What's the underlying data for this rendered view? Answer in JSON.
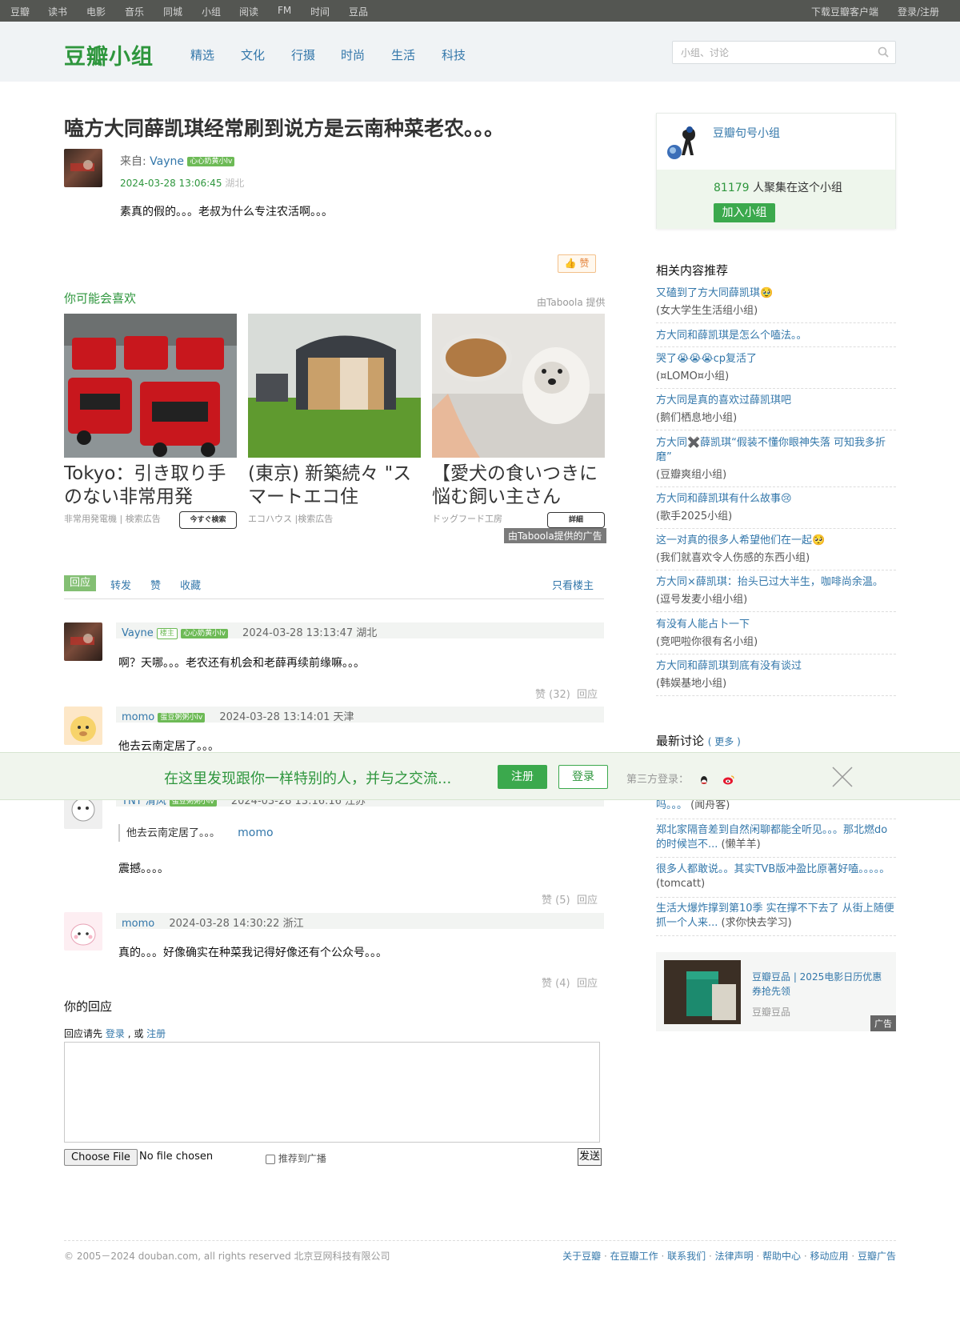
{
  "topnav": {
    "items": [
      "豆瓣",
      "读书",
      "电影",
      "音乐",
      "同城",
      "小组",
      "阅读",
      "FM",
      "时间",
      "豆品"
    ],
    "download": "下载豆瓣客户端",
    "login": "登录/注册"
  },
  "header": {
    "logo": "豆瓣小组",
    "nav": [
      "精选",
      "文化",
      "行摄",
      "时尚",
      "生活",
      "科技"
    ],
    "search_placeholder": "小组、讨论"
  },
  "topic": {
    "title": "嗑方大同薛凯琪经常刷到说方是云南种菜老农。。。",
    "from_label": "来自:",
    "author": "Vayne",
    "author_badge": "心心奶黄小lv",
    "time": "2024-03-28 13:06:45",
    "location": "湖北",
    "content": "素真的假的。。。老叔为什么专注农活啊。。。",
    "like_label": "赞"
  },
  "recommend": {
    "title": "你可能会喜欢",
    "provider": "由Taboola 提供",
    "ads": [
      {
        "title": "Tokyo：引き取り手のない非常用発",
        "source": "非常用発電機 | 検索広告",
        "cta": "今すぐ検索"
      },
      {
        "title": "(東京) 新築続々 \"スマートエコ住",
        "source": "エコハウス |検索広告",
        "cta": ""
      },
      {
        "title": "【愛犬の食いつきに悩む飼い主さん",
        "source": "ドッグフード工房",
        "cta": "詳細"
      }
    ],
    "taboola_tag": "由Taboola提供的广告"
  },
  "tabs": {
    "reply": "回应",
    "repost": "转发",
    "like": "赞",
    "collect": "收藏",
    "only_op": "只看楼主"
  },
  "replies": [
    {
      "name": "Vayne",
      "owner_badge": "楼主",
      "badge": "心心奶黄小lv",
      "time": "2024-03-28 13:13:47 湖北",
      "text": "啊？天哪。。。老农还有机会和老薛再续前缘嘛。。。",
      "likes": "赞 (32)",
      "reply": "回应"
    },
    {
      "name": "momo",
      "badge": "蛋豆粥粥小lv",
      "time": "2024-03-28 13:14:01 天津",
      "text": "他去云南定居了。。。"
    },
    {
      "name": "TNT 清风",
      "badge": "蛋豆粥粥小lv",
      "time": "2024-03-28 13:16:16 江苏",
      "quote": "他去云南定居了。。。",
      "quote_author": "momo",
      "text": "震撼。。。。",
      "likes": "赞 (5)",
      "reply": "回应"
    },
    {
      "name": "momo",
      "time": "2024-03-28 14:30:22 浙江",
      "text": "真的。。。好像确实在种菜我记得好像还有个公众号。。。",
      "likes": "赞 (4)",
      "reply": "回应"
    }
  ],
  "your_reply": {
    "title": "你的回应",
    "prompt_prefix": "回应请先",
    "login": "登录",
    "or": ", 或",
    "register": "注册",
    "file_button": "Choose File",
    "file_status": "No file chosen",
    "recommend_checkbox": "推荐到广播",
    "send": "发送"
  },
  "group": {
    "name": "豆瓣句号小组",
    "count": "81179",
    "count_suffix": "人聚集在这个小组",
    "join": "加入小组"
  },
  "related": {
    "title": "相关内容推荐",
    "items": [
      {
        "title": "又磕到了方大同薛凯琪🥹",
        "group": "(女大学生生活组小组)"
      },
      {
        "title": "方大同和薛凯琪是怎么个嗑法。。",
        "group": ""
      },
      {
        "title": "哭了😭😭😭cp复活了",
        "group": "(¤LOMO¤小组)"
      },
      {
        "title": "方大同是真的喜欢过薛凯琪吧",
        "group": "(鹅们栖息地小组)"
      },
      {
        "title": "方大同✖️薛凯琪“假装不懂你眼神失落 可知我多折磨”",
        "group": "(豆瓣爽组小组)"
      },
      {
        "title": "方大同和薛凯琪有什么故事😢",
        "group": "(歌手2025小组)"
      },
      {
        "title": "这一对真的很多人希望他们在一起🥺",
        "group": "(我们就喜欢令人伤感的东西小组)"
      },
      {
        "title": "方大同×薛凯琪：抬头已过大半生，咖啡尚余温。",
        "group": "(逗号发麦小组小组)"
      },
      {
        "title": "有没有人能占卜一下",
        "group": "(竞吧啦你很有名小组)"
      },
      {
        "title": "方大同和薛凯琪到底有没有谈过",
        "group": "(韩娱基地小组)"
      }
    ]
  },
  "latest": {
    "title": "最新讨论",
    "more": "( 更多 )",
    "items": [
      {
        "title": "吗。。。",
        "author": "(闻舟客)"
      },
      {
        "title": "郑北家隔音差到自然闲聊都能全听见。。。那北燃do的时候岂不...",
        "author": "(懒羊羊)"
      },
      {
        "title": "很多人都敢说。。其实TVB版冲盈比原著好嗑。。。。。",
        "author": "(tomcatt)"
      },
      {
        "title": "生活大爆炸撑到第10季 实在撑不下去了 从街上随便抓一个人来...",
        "author": "(求你快去学习)"
      }
    ]
  },
  "promo": {
    "title": "豆瓣豆品 | 2025电影日历优惠券抢先领",
    "source": "豆瓣豆品",
    "tag": "广告"
  },
  "loginbar": {
    "text": "在这里发现跟你一样特别的人，并与之交流...",
    "register": "注册",
    "login": "登录",
    "third": "第三方登录："
  },
  "footer": {
    "copyright": "© 2005－2024 douban.com, all rights reserved 北京豆网科技有限公司",
    "links": [
      "关于豆瓣",
      "在豆瓣工作",
      "联系我们",
      "法律声明",
      "帮助中心",
      "移动应用",
      "豆瓣广告"
    ]
  },
  "colors": {
    "douban_green": "#2e963d",
    "link_blue": "#3377aa",
    "topbar": "#545652"
  }
}
